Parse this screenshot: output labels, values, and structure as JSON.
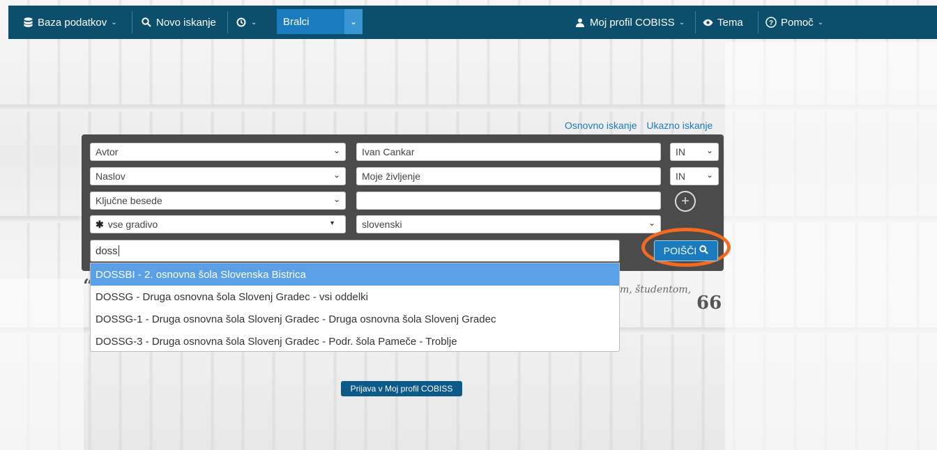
{
  "nav": {
    "database_label": "Baza podatkov",
    "new_search_label": "Novo iskanje",
    "role_value": "Bralci",
    "profile_label": "Moj profil COBISS",
    "theme_label": "Tema",
    "help_label": "Pomoč"
  },
  "search_modes": {
    "basic": "Osnovno iskanje",
    "command": "Ukazno iskanje"
  },
  "rows": [
    {
      "field": "Avtor",
      "value": "Ivan Cankar",
      "operator": "IN"
    },
    {
      "field": "Naslov",
      "value": "Moje življenje",
      "operator": "IN"
    },
    {
      "field": "Ključne besede",
      "value": ""
    }
  ],
  "filters": {
    "material": "vse gradivo",
    "language": "slovenski"
  },
  "library": {
    "input_value": "doss",
    "suggestions": [
      "DOSSBI - 2. osnovna šola Slovenska Bistrica",
      "DOSSG - Druga osnovna šola Slovenj Gradec - vsi oddelki",
      "DOSSG-1 - Druga osnovna šola Slovenj Gradec - Druga osnovna šola Slovenj Gradec",
      "DOSSG-3 - Druga osnovna šola Slovenj Gradec - Podr. šola Pameče - Troblje"
    ]
  },
  "search_button": "POIŠČI",
  "quote": {
    "fragment": "m, študentom,",
    "mark": "66"
  },
  "login_button": "Prijava v Moj profil COBISS",
  "colors": {
    "nav_bg": "#0b4f6c",
    "accent": "#1a7bbf",
    "highlight_ring": "#f26b21",
    "dropdown_active": "#5aa0e6"
  }
}
